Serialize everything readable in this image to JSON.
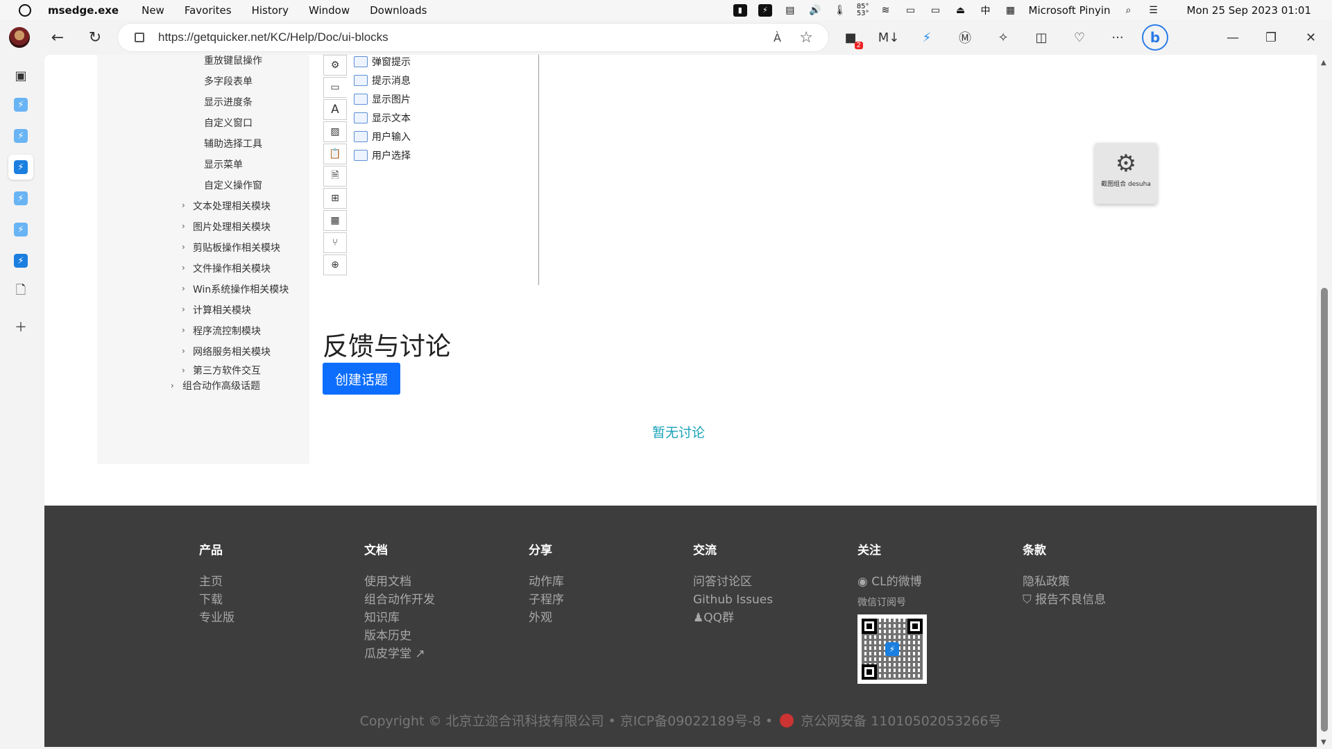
{
  "menubar": {
    "app_name": "msedge.exe",
    "items": [
      "New",
      "Favorites",
      "History",
      "Window",
      "Downloads"
    ],
    "temp_hi": "85°",
    "temp_lo": "53°",
    "ime": "Microsoft Pinyin",
    "clock": "Mon 25 Sep 2023 01:01"
  },
  "browser": {
    "url": "https://getquicker.net/KC/Help/Doc/ui-blocks",
    "readaloud_label": "À",
    "ext_badge": "2",
    "bing_label": "b"
  },
  "tree": {
    "leaf_items": [
      "重放键鼠操作",
      "多字段表单",
      "显示进度条",
      "自定义窗口",
      "辅助选择工具",
      "显示菜单",
      "自定义操作窗"
    ],
    "sections": [
      "文本处理相关模块",
      "图片处理相关模块",
      "剪贴板操作相关模块",
      "文件操作相关模块",
      "Win系统操作相关模块",
      "计算相关模块",
      "程序流控制模块",
      "网络服务相关模块",
      "第三方软件交互"
    ],
    "advanced": "组合动作高级话题"
  },
  "blocks": {
    "items": [
      "弹窗提示",
      "提示消息",
      "显示图片",
      "显示文本",
      "用户输入",
      "用户选择"
    ]
  },
  "float_card": {
    "caption": "截图组合 desuha"
  },
  "feedback": {
    "title": "反馈与讨论",
    "create_button": "创建话题",
    "empty_text": "暂无讨论"
  },
  "footer": {
    "columns": [
      {
        "heading": "产品",
        "links": [
          "主页",
          "下载",
          "专业版"
        ]
      },
      {
        "heading": "文档",
        "links": [
          "使用文档",
          "组合动作开发",
          "知识库",
          "版本历史",
          "瓜皮学堂"
        ]
      },
      {
        "heading": "分享",
        "links": [
          "动作库",
          "子程序",
          "外观"
        ]
      },
      {
        "heading": "交流",
        "links": [
          "问答讨论区",
          "Github Issues",
          "QQ群"
        ]
      },
      {
        "heading": "关注",
        "links": [
          "CL的微博"
        ],
        "wechat_label": "微信订阅号"
      },
      {
        "heading": "条款",
        "links": [
          "隐私政策",
          "报告不良信息"
        ]
      }
    ],
    "copyright": "Copyright © 北京立迩合讯科技有限公司 • 京ICP备09022189号-8 •",
    "police": "京公网安备 11010502053266号"
  }
}
